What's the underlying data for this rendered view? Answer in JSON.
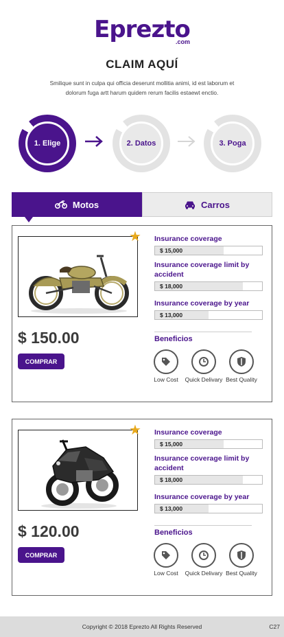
{
  "brand": {
    "logo_text": "Eprezto",
    "logo_sub": ".com"
  },
  "header": {
    "title": "CLAIM AQUÍ",
    "subtitle": "Smilique sunt in culpa qui officia deserunt mollitia animi, id est laborum et dolorum fuga artt harum quidem rerum facilis estaewt enctio."
  },
  "steps": [
    {
      "label": "1. Elige",
      "active": true
    },
    {
      "label": "2. Datos",
      "active": false
    },
    {
      "label": "3. Poga",
      "active": false
    }
  ],
  "tabs": [
    {
      "label": "Motos",
      "icon": "motorcycle-icon",
      "active": true
    },
    {
      "label": "Carros",
      "icon": "car-icon",
      "active": false
    }
  ],
  "colors": {
    "brand": "#4a148c",
    "star": "#e8a91c",
    "inactive": "#e9e9e9"
  },
  "products": [
    {
      "price": "$ 150.00",
      "buy_label": "COMPRAR",
      "image": "vintage-motorcycle",
      "featured_icon": "star-icon",
      "coverages": [
        {
          "label": "Insurance coverage",
          "value": "$ 15,000",
          "level": 0.64
        },
        {
          "label": "Insurance coverage limit by accident",
          "value": "$ 18,000",
          "level": 0.82
        },
        {
          "label": "Insurance coverage by year",
          "value": "$ 13,000",
          "level": 0.5
        }
      ],
      "benefits_title": "Beneficios",
      "benefits": [
        {
          "label": "Low Cost",
          "icon": "tag-icon"
        },
        {
          "label": "Quick Delivary",
          "icon": "clock-icon"
        },
        {
          "label": "Best Quality",
          "icon": "shield-icon"
        }
      ]
    },
    {
      "price": "$ 120.00",
      "buy_label": "COMPRAR",
      "image": "sport-motorcycle",
      "featured_icon": "star-icon",
      "coverages": [
        {
          "label": "Insurance coverage",
          "value": "$ 15,000",
          "level": 0.64
        },
        {
          "label": "Insurance coverage limit by accident",
          "value": "$ 18,000",
          "level": 0.82
        },
        {
          "label": "Insurance coverage by year",
          "value": "$ 13,000",
          "level": 0.5
        }
      ],
      "benefits_title": "Beneficios",
      "benefits": [
        {
          "label": "Low Cost",
          "icon": "tag-icon"
        },
        {
          "label": "Quick Delivary",
          "icon": "clock-icon"
        },
        {
          "label": "Best Quality",
          "icon": "shield-icon"
        }
      ]
    }
  ],
  "footer": {
    "copyright": "Copyright © 2018 Eprezto All Rights Reserved",
    "corner": "C27"
  }
}
